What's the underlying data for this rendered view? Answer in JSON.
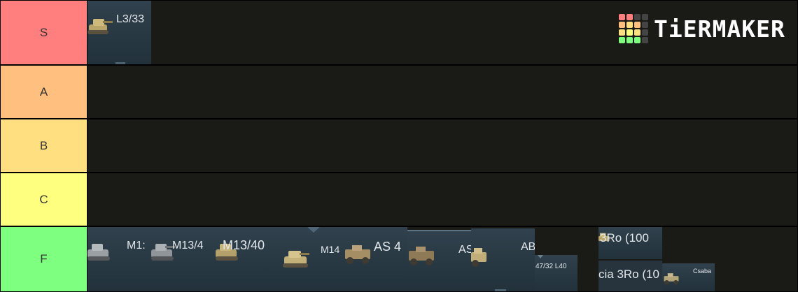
{
  "logo": {
    "text": "TiERMAKER",
    "colors": [
      "#ff7f7f",
      "#ff7f7f",
      "#444444",
      "#444444",
      "#ffbf7f",
      "#ffdf7f",
      "#ffbf7f",
      "#444444",
      "#ffdf7f",
      "#ffff7f",
      "#ffdf7f",
      "#444444",
      "#7fff7f",
      "#7fff7f",
      "#7fff7f",
      "#444444"
    ]
  },
  "tiers": [
    {
      "label": "S",
      "color": "#ff7f7f"
    },
    {
      "label": "A",
      "color": "#ffbf7f"
    },
    {
      "label": "B",
      "color": "#ffdf7f"
    },
    {
      "label": "C",
      "color": "#ffff7f"
    },
    {
      "label": "F",
      "color": "#7fff7f"
    }
  ],
  "items": {
    "s": [
      "L3/33"
    ],
    "f": [
      "M1:",
      "M13/4",
      "M13/40",
      "M14",
      "AS 4",
      "AS",
      "AB",
      "47/32 L40",
      "3Ro (100",
      "cia 3Ro (10",
      "Csaba"
    ]
  }
}
